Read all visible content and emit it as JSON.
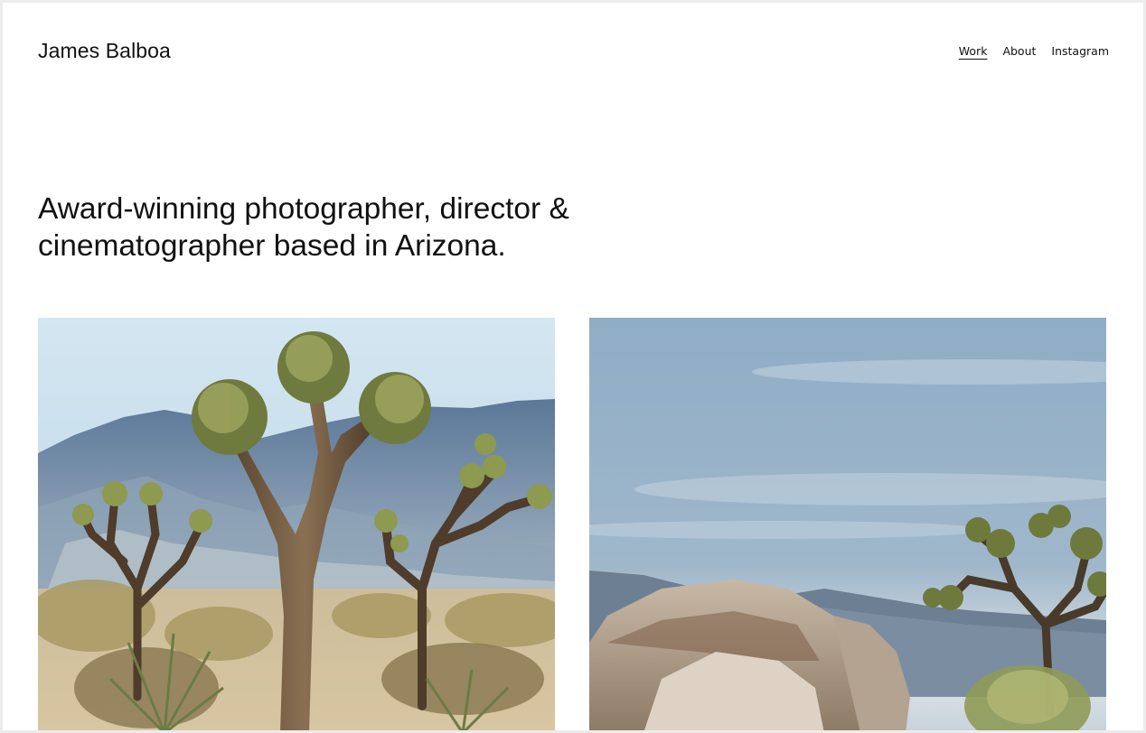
{
  "header": {
    "site_title": "James Balboa",
    "nav": [
      {
        "label": "Work",
        "active": true
      },
      {
        "label": "About",
        "active": false
      },
      {
        "label": "Instagram",
        "active": false
      }
    ]
  },
  "hero": {
    "tagline": "Award-winning photographer, director & cinematographer based in Arizona."
  },
  "gallery": {
    "items": [
      {
        "subject": "joshua-tree-desert-mountains"
      },
      {
        "subject": "joshua-tree-rocks-cloudy-sky"
      }
    ]
  }
}
